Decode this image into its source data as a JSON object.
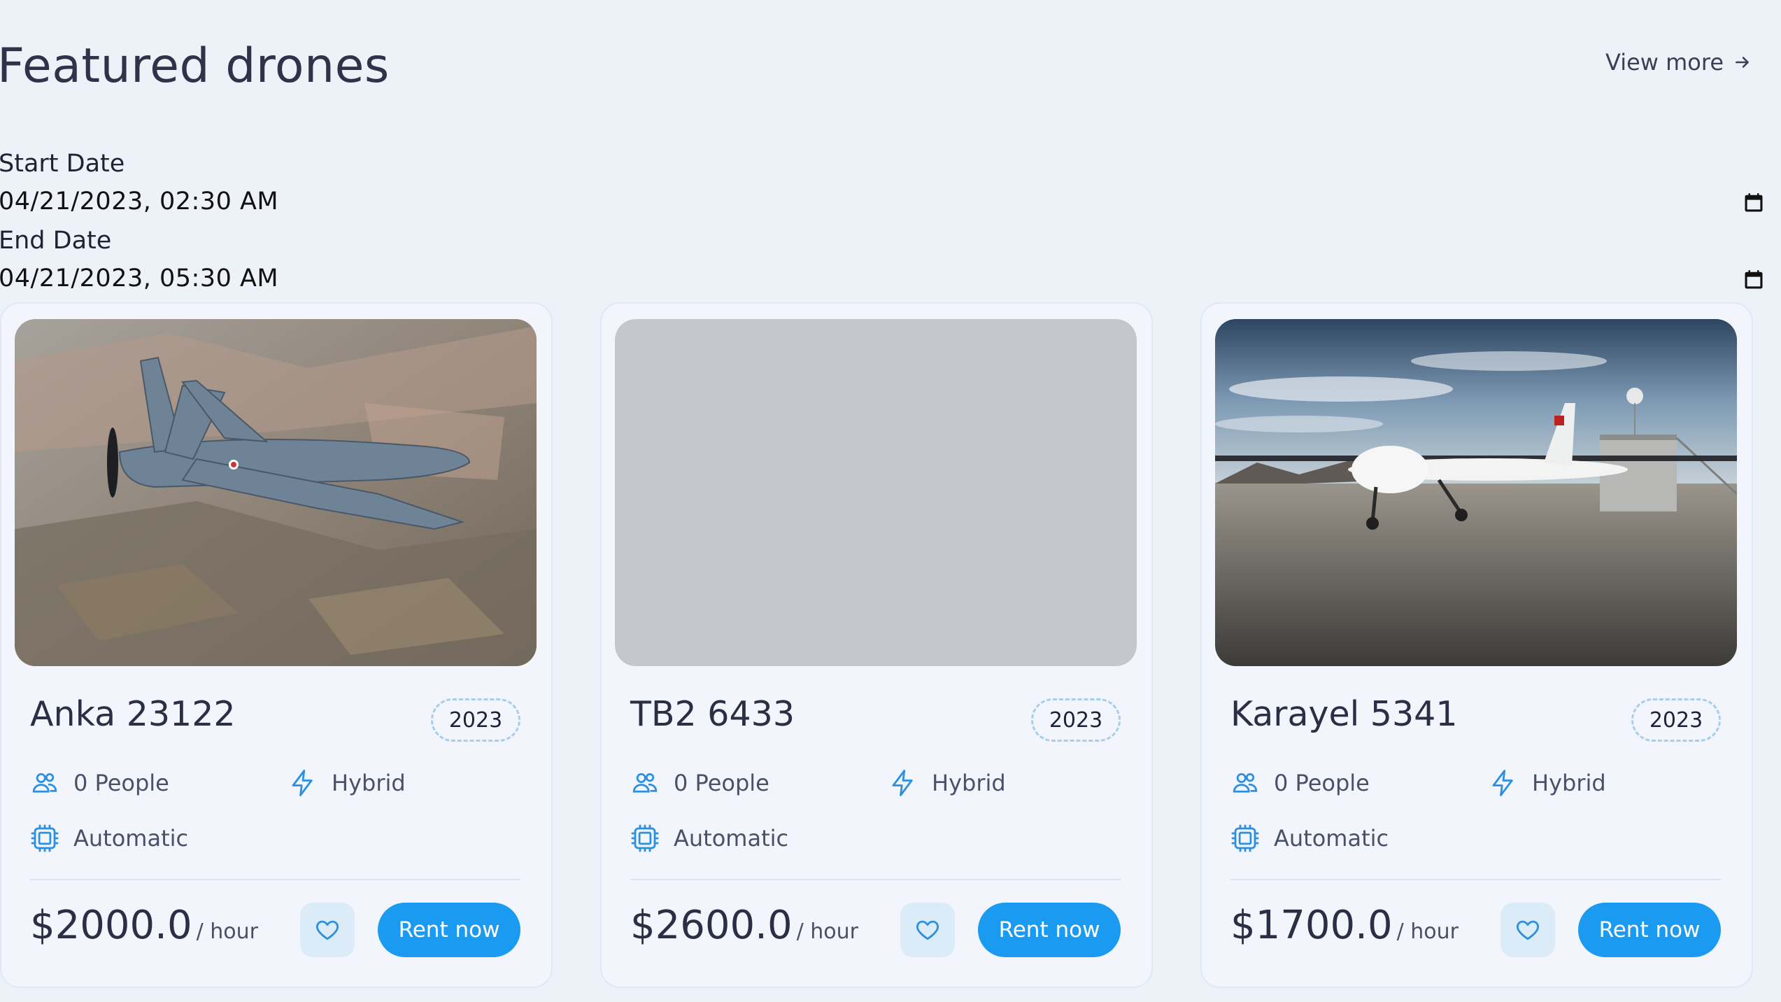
{
  "header": {
    "title": "Featured drones",
    "view_more": "View more"
  },
  "dates": {
    "start_label": "Start Date",
    "start_value": "04/21/2023, 02:30 AM",
    "end_label": "End Date",
    "end_value": "04/21/2023, 05:30 AM"
  },
  "icons": {
    "arrow": "arrow-right-icon",
    "calendar": "calendar-icon",
    "people": "people-icon",
    "lightning": "lightning-icon",
    "chip": "chip-icon",
    "heart": "heart-icon"
  },
  "colors": {
    "accent": "#1b9af2",
    "background": "#edf2f9",
    "card": "#f2f6fc"
  },
  "cards": [
    {
      "name": "Anka 23122",
      "year": "2023",
      "people": "0 People",
      "power": "Hybrid",
      "mode": "Automatic",
      "price": "$2000.0",
      "unit": "/ hour",
      "cta": "Rent now",
      "image": "gray drone flying over farmland"
    },
    {
      "name": "TB2 6433",
      "year": "2023",
      "people": "0 People",
      "power": "Hybrid",
      "mode": "Automatic",
      "price": "$2600.0",
      "unit": "/ hour",
      "cta": "Rent now",
      "image": "image placeholder"
    },
    {
      "name": "Karayel 5341",
      "year": "2023",
      "people": "0 People",
      "power": "Hybrid",
      "mode": "Automatic",
      "price": "$1700.0",
      "unit": "/ hour",
      "cta": "Rent now",
      "image": "white drone on airfield"
    }
  ]
}
